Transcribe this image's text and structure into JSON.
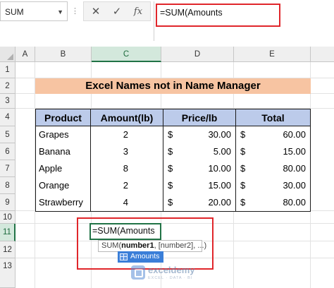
{
  "formula_bar": {
    "name_box": "SUM",
    "cancel_icon": "✕",
    "enter_icon": "✓",
    "fx_label": "fx",
    "formula": "=SUM(Amounts"
  },
  "columns": [
    "A",
    "B",
    "C",
    "D",
    "E"
  ],
  "rows": [
    "1",
    "2",
    "3",
    "4",
    "5",
    "6",
    "7",
    "8",
    "9",
    "10",
    "11",
    "12",
    "13"
  ],
  "selected_column": "C",
  "selected_row": "11",
  "sheet": {
    "title": "Excel Names not in Name Manager",
    "headers": [
      "Product",
      "Amount(lb)",
      "Price/lb",
      "Total"
    ],
    "table_rows": [
      {
        "product": "Grapes",
        "amount": "2",
        "price_cur": "$",
        "price": "30.00",
        "total_cur": "$",
        "total": "60.00"
      },
      {
        "product": "Banana",
        "amount": "3",
        "price_cur": "$",
        "price": "5.00",
        "total_cur": "$",
        "total": "15.00"
      },
      {
        "product": "Apple",
        "amount": "8",
        "price_cur": "$",
        "price": "10.00",
        "total_cur": "$",
        "total": "80.00"
      },
      {
        "product": "Orange",
        "amount": "2",
        "price_cur": "$",
        "price": "15.00",
        "total_cur": "$",
        "total": "30.00"
      },
      {
        "product": "Strawberry",
        "amount": "4",
        "price_cur": "$",
        "price": "20.00",
        "total_cur": "$",
        "total": "80.00"
      }
    ],
    "editing_cell": "=SUM(Amounts",
    "tooltip": {
      "fn": "SUM(",
      "bold_arg": "number1",
      "rest": ", [number2], ...)"
    },
    "autocomplete": "Amounts"
  },
  "watermark": {
    "name": "exceldemy",
    "tagline": "EXCEL · DATA · BI"
  },
  "colors": {
    "accent": "#217346",
    "highlight": "#e0262b",
    "title_fill": "#f7c4a2",
    "header_fill": "#bccbea"
  }
}
